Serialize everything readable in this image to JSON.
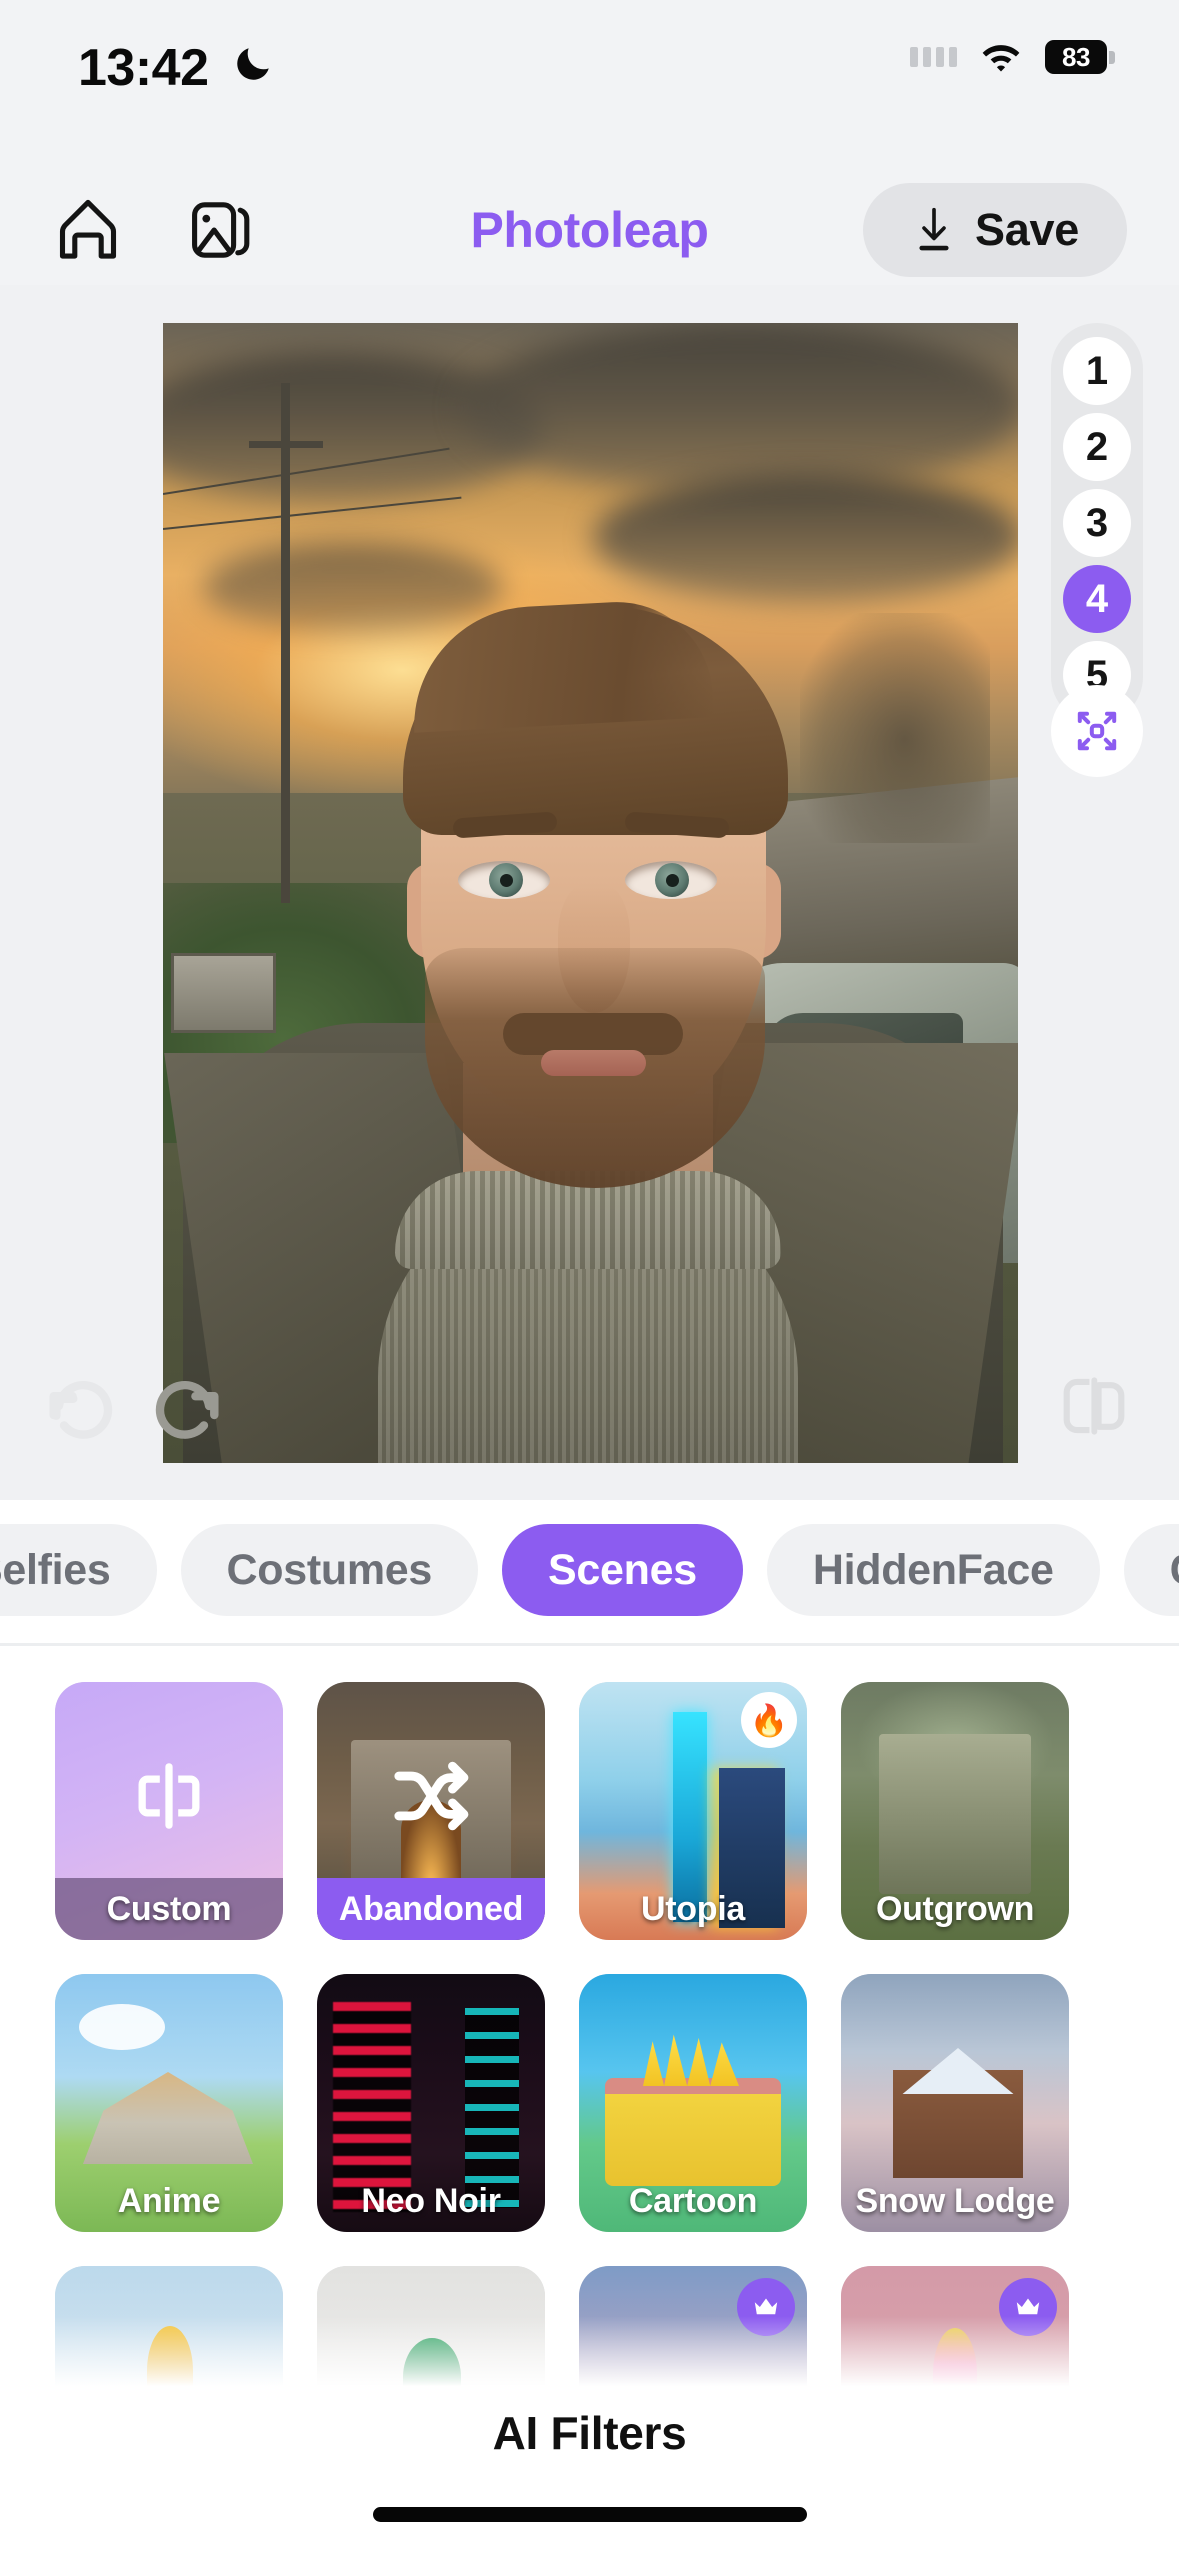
{
  "status_bar": {
    "time": "13:42",
    "dnd_icon": "crescent-moon-icon",
    "signal_icon": "signal-dots-icon",
    "wifi_icon": "wifi-icon",
    "battery_level": "83"
  },
  "header": {
    "home_icon": "home-icon",
    "gallery_icon": "gallery-icon",
    "title": "Photoleap",
    "title_color": "#8c5cf0",
    "save_label": "Save",
    "save_icon": "download-icon"
  },
  "canvas": {
    "layer_chips": [
      "1",
      "2",
      "3",
      "4",
      "5"
    ],
    "active_layer": "4",
    "expand_icon": "expand-icon",
    "undo_icon": "undo-icon",
    "redo_icon": "redo-icon",
    "compare_icon": "compare-icon",
    "accent_color": "#8c5cf0"
  },
  "tabs": [
    {
      "label": "Selfies",
      "active": false
    },
    {
      "label": "Costumes",
      "active": false
    },
    {
      "label": "Scenes",
      "active": true
    },
    {
      "label": "HiddenFace",
      "active": false
    },
    {
      "label": "Cartoon",
      "active": false
    }
  ],
  "filters": {
    "rows": [
      [
        {
          "label": "Custom",
          "art": "art-custom",
          "icon": "text-cursor-icon",
          "badge": "",
          "selected": false,
          "custom": true
        },
        {
          "label": "Abandoned",
          "art": "art-abandoned",
          "icon": "shuffle-icon",
          "badge": "",
          "selected": true,
          "custom": false
        },
        {
          "label": "Utopia",
          "art": "art-utopia",
          "icon": "",
          "badge": "fire",
          "selected": false,
          "custom": false
        },
        {
          "label": "Outgrown",
          "art": "art-outgrown",
          "icon": "",
          "badge": "",
          "selected": false,
          "custom": false
        }
      ],
      [
        {
          "label": "Anime",
          "art": "art-anime",
          "icon": "",
          "badge": "",
          "selected": false,
          "custom": false
        },
        {
          "label": "Neo Noir",
          "art": "art-neonoir",
          "icon": "",
          "badge": "",
          "selected": false,
          "custom": false
        },
        {
          "label": "Cartoon",
          "art": "art-cartoon",
          "icon": "",
          "badge": "",
          "selected": false,
          "custom": false
        },
        {
          "label": "Snow Lodge",
          "art": "art-snow",
          "icon": "",
          "badge": "",
          "selected": false,
          "custom": false
        }
      ],
      [
        {
          "label": "",
          "art": "art-r3a",
          "icon": "",
          "badge": "",
          "selected": false,
          "custom": false
        },
        {
          "label": "",
          "art": "art-r3b",
          "icon": "",
          "badge": "",
          "selected": false,
          "custom": false
        },
        {
          "label": "",
          "art": "art-r3c",
          "icon": "",
          "badge": "crown",
          "selected": false,
          "custom": false
        },
        {
          "label": "",
          "art": "art-r3d",
          "icon": "",
          "badge": "crown",
          "selected": false,
          "custom": false
        }
      ]
    ]
  },
  "footer": {
    "section_label": "AI Filters"
  }
}
